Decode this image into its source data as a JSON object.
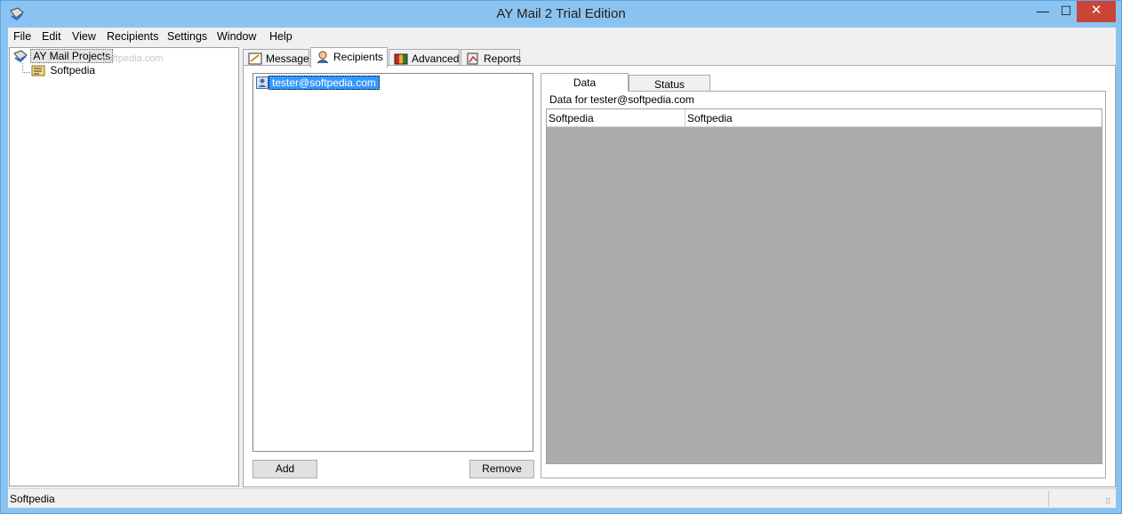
{
  "window": {
    "title": "AY Mail 2 Trial Edition",
    "min": "—",
    "max": "☐",
    "close": "✕"
  },
  "menu": [
    "File",
    "Edit",
    "View",
    "Recipients",
    "Settings",
    "Window",
    "Help"
  ],
  "tree": {
    "root": "AY Mail Projects",
    "watermark": "softpedia.com",
    "child": "Softpedia"
  },
  "tabs": [
    "Message",
    "Recipients",
    "Advanced",
    "Reports"
  ],
  "recipients": {
    "items": [
      "tester@softpedia.com"
    ],
    "add_label": "Add",
    "remove_label": "Remove"
  },
  "detail": {
    "tabs": [
      "Data",
      "Status"
    ],
    "data_for": "Data for tester@softpedia.com",
    "rows": [
      [
        "Softpedia",
        "Softpedia"
      ]
    ]
  },
  "status": {
    "text": "Softpedia"
  }
}
